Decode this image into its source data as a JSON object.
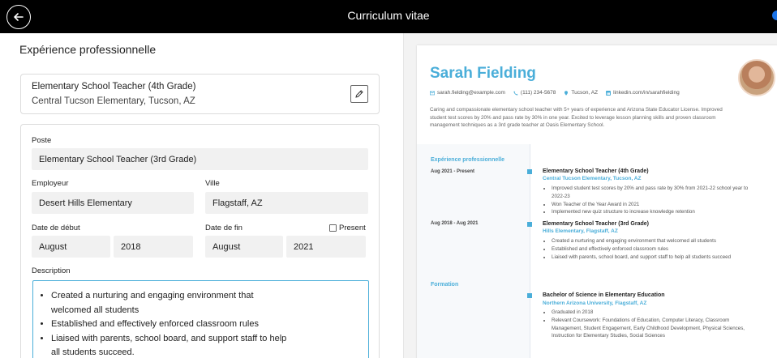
{
  "header": {
    "title": "Curriculum vitae"
  },
  "editor": {
    "section_title": "Expérience professionnelle",
    "entry": {
      "role": "Elementary School Teacher (4th Grade)",
      "employer": "Central Tucson Elementary, Tucson, AZ"
    },
    "form": {
      "position_label": "Poste",
      "position_value": "Elementary School Teacher (3rd Grade)",
      "employer_label": "Employeur",
      "employer_value": "Desert Hills Elementary",
      "city_label": "Ville",
      "city_value": "Flagstaff, AZ",
      "start_label": "Date de début",
      "start_month": "August",
      "start_year": "2018",
      "end_label": "Date de fin",
      "end_month": "August",
      "end_year": "2021",
      "present_label": "Present",
      "present_checked": false,
      "description_label": "Description",
      "description_items": [
        "Created a nurturing and engaging environment that welcomed all students",
        "Established and effectively enforced classroom rules",
        "Liaised with parents, school board, and support staff to help all students succeed."
      ]
    }
  },
  "preview": {
    "name": "Sarah Fielding",
    "email": "sarah.fielding@example.com",
    "phone": "(111) 234-5678",
    "location": "Tucson, AZ",
    "linkedin": "linkedin.com/in/sarahfielding",
    "summary": "Caring and compassionate elementary school teacher with 5+ years of experience and Arizona State Educator License. Improved student test scores by 20% and pass rate by 30% in one year. Excited to leverage lesson planning skills and proven classroom management techniques as a 3rd grade teacher at Oasis Elementary School.",
    "experience_heading": "Expérience professionnelle",
    "jobs": [
      {
        "dates": "Aug 2021 - Present",
        "title": "Elementary School Teacher (4th Grade)",
        "employer": "Central Tucson Elementary, Tucson, AZ",
        "bullets": [
          "Improved student test scores by 20% and pass rate by 30% from 2021-22 school year to 2022-23",
          "Won Teacher of the Year Award in 2021",
          "Implemented new quiz structure to increase knowledge retention"
        ]
      },
      {
        "dates": "Aug 2018 - Aug 2021",
        "title": "Elementary School Teacher (3rd Grade)",
        "employer": "Hills Elementary, Flagstaff, AZ",
        "bullets": [
          "Created a nurturing and engaging environment that welcomed all students",
          "Established and effectively enforced classroom rules",
          "Liaised with parents, school board, and support staff to help all students succeed"
        ]
      }
    ],
    "education_heading": "Formation",
    "education": {
      "degree": "Bachelor of Science in Elementary Education",
      "school": "Northern Arizona University, Flagstaff, AZ",
      "bullets": [
        "Graduated in 2018",
        "Relevant Coursework: Foundations of Education, Computer Literacy, Classroom Management, Student Engagement, Early Childhood Development, Physical Sciences, Instruction for Elementary Studies, Social Sciences"
      ]
    },
    "accent_color": "#4aaed9"
  }
}
